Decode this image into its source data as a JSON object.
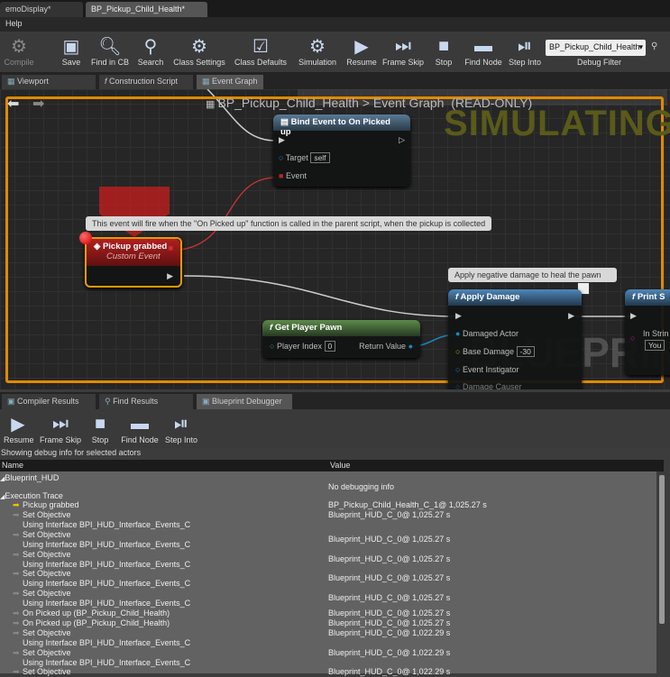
{
  "document_tabs": [
    {
      "label": "emoDisplay*"
    },
    {
      "label": "BP_Pickup_Child_Health*",
      "active": true
    }
  ],
  "menu": {
    "help": "Help"
  },
  "toolbar": {
    "compile": "Compile",
    "save": "Save",
    "find_in_cb": "Find in CB",
    "search": "Search",
    "class_settings": "Class Settings",
    "class_defaults": "Class Defaults",
    "simulation": "Simulation",
    "resume": "Resume",
    "frame_skip": "Frame Skip",
    "stop": "Stop",
    "find_node": "Find Node",
    "step_into": "Step Into",
    "debug_filter_value": "BP_Pickup_Child_Health",
    "debug_filter_label": "Debug Filter"
  },
  "editor_tabs": [
    {
      "label": "Viewport"
    },
    {
      "label": "Construction Script"
    },
    {
      "label": "Event Graph",
      "active": true
    }
  ],
  "graph": {
    "breadcrumb_blueprint": "BP_Pickup_Child_Health",
    "breadcrumb_sep": ">",
    "breadcrumb_graph": "Event Graph",
    "read_only": "(READ-ONLY)",
    "simulating": "SIMULATING",
    "watermark": "BLUEPRINT",
    "bind_node": {
      "title": "Bind Event to On Picked up",
      "target": "Target",
      "target_value": "self",
      "event": "Event"
    },
    "comment_event": "This event will fire when the \"On Picked up\" function is called in the parent script, when the pickup is collected",
    "event_node": {
      "title": "Pickup grabbed",
      "subtitle": "Custom Event"
    },
    "comment_damage": "Apply negative damage to heal the pawn",
    "apply_damage": {
      "title": "Apply Damage",
      "damaged_actor": "Damaged Actor",
      "base_damage": "Base Damage",
      "base_damage_value": "-30",
      "event_instigator": "Event Instigator",
      "damage_causer": "Damage Causer"
    },
    "get_player_pawn": {
      "title": "Get Player Pawn",
      "player_index": "Player Index",
      "player_index_value": "0",
      "return_value": "Return Value"
    },
    "print_node": {
      "title": "Print S",
      "in_string": "In Strin",
      "value": "You"
    }
  },
  "bottom_tabs": [
    {
      "label": "Compiler Results"
    },
    {
      "label": "Find Results"
    },
    {
      "label": "Blueprint Debugger",
      "active": true
    }
  ],
  "debugger": {
    "resume": "Resume",
    "frame_skip": "Frame Skip",
    "stop": "Stop",
    "find_node": "Find Node",
    "step_into": "Step Into",
    "status": "Showing debug info for selected actors",
    "col_name": "Name",
    "col_value": "Value",
    "blueprint_hud": "Blueprint_HUD",
    "no_debug": "No debugging info",
    "execution_trace": "Execution Trace",
    "trace": [
      {
        "name": "Pickup grabbed",
        "value": "BP_Pickup_Child_Health_C_1@ 1,025.27 s",
        "current": true
      },
      {
        "name": "Set Objective",
        "sub": "Using Interface BPI_HUD_Interface_Events_C",
        "value": "Blueprint_HUD_C_0@ 1,025.27 s"
      },
      {
        "name": "Set Objective",
        "sub": "Using Interface BPI_HUD_Interface_Events_C",
        "value": "Blueprint_HUD_C_0@ 1,025.27 s"
      },
      {
        "name": "Set Objective",
        "sub": "Using Interface BPI_HUD_Interface_Events_C",
        "value": "Blueprint_HUD_C_0@ 1,025.27 s"
      },
      {
        "name": "Set Objective",
        "sub": "Using Interface BPI_HUD_Interface_Events_C",
        "value": "Blueprint_HUD_C_0@ 1,025.27 s"
      },
      {
        "name": "Set Objective",
        "sub": "Using Interface BPI_HUD_Interface_Events_C",
        "value": "Blueprint_HUD_C_0@ 1,025.27 s"
      },
      {
        "name": "On Picked up (BP_Pickup_Child_Health)",
        "value": "Blueprint_HUD_C_0@ 1,025.27 s"
      },
      {
        "name": "On Picked up (BP_Pickup_Child_Health)",
        "value": "Blueprint_HUD_C_0@ 1,025.27 s"
      },
      {
        "name": "Set Objective",
        "sub": "Using Interface BPI_HUD_Interface_Events_C",
        "value": "Blueprint_HUD_C_0@ 1,022.29 s"
      },
      {
        "name": "Set Objective",
        "sub": "Using Interface BPI_HUD_Interface_Events_C",
        "value": "Blueprint_HUD_C_0@ 1,022.29 s"
      },
      {
        "name": "Set Objective",
        "value": "Blueprint_HUD_C_0@ 1,022.29 s"
      }
    ]
  }
}
